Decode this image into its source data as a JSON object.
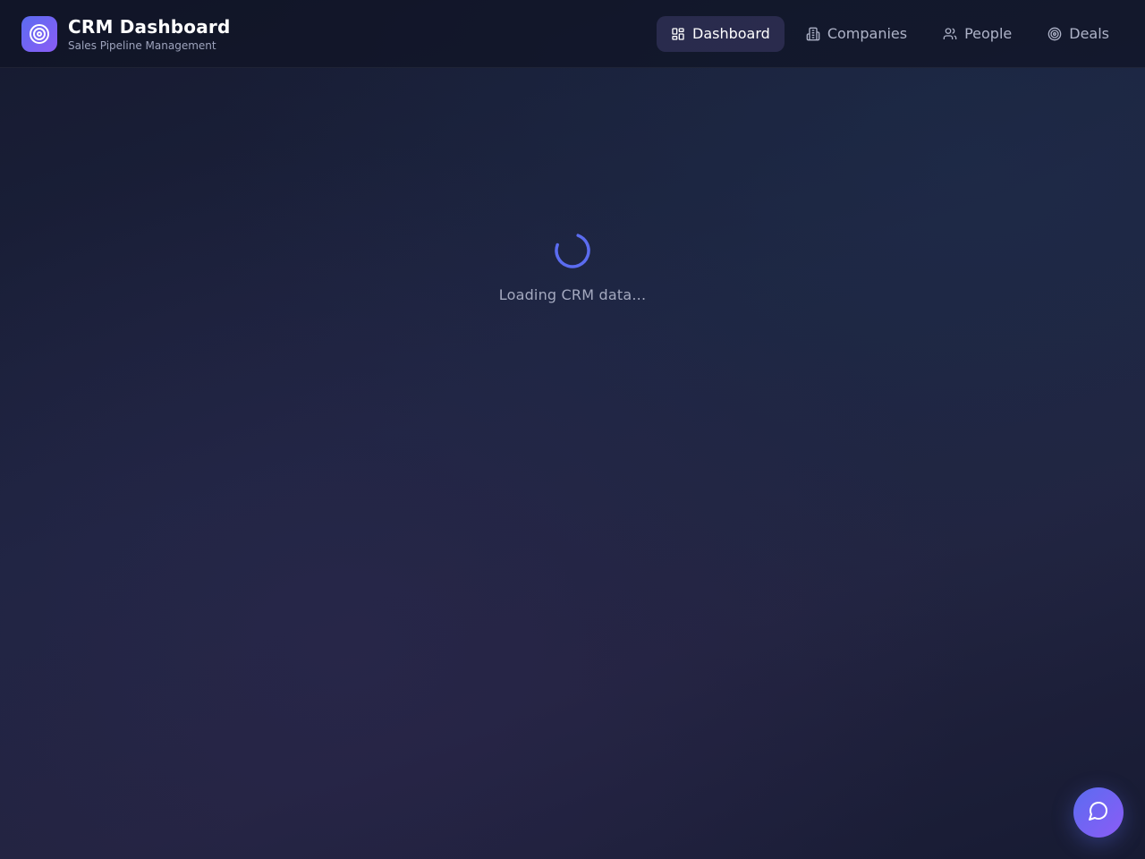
{
  "header": {
    "title": "CRM Dashboard",
    "subtitle": "Sales Pipeline Management",
    "logo_icon": "target-icon"
  },
  "nav": {
    "items": [
      {
        "label": "Dashboard",
        "icon": "grid-icon",
        "active": true
      },
      {
        "label": "Companies",
        "icon": "building-icon",
        "active": false
      },
      {
        "label": "People",
        "icon": "users-icon",
        "active": false
      },
      {
        "label": "Deals",
        "icon": "target-icon",
        "active": false
      }
    ]
  },
  "loading": {
    "text": "Loading CRM data..."
  },
  "chat": {
    "icon": "chat-bubble-icon"
  },
  "colors": {
    "accent": "#5b6cf0",
    "accent_secondary": "#8b5cf6",
    "background": "#1d2440"
  }
}
